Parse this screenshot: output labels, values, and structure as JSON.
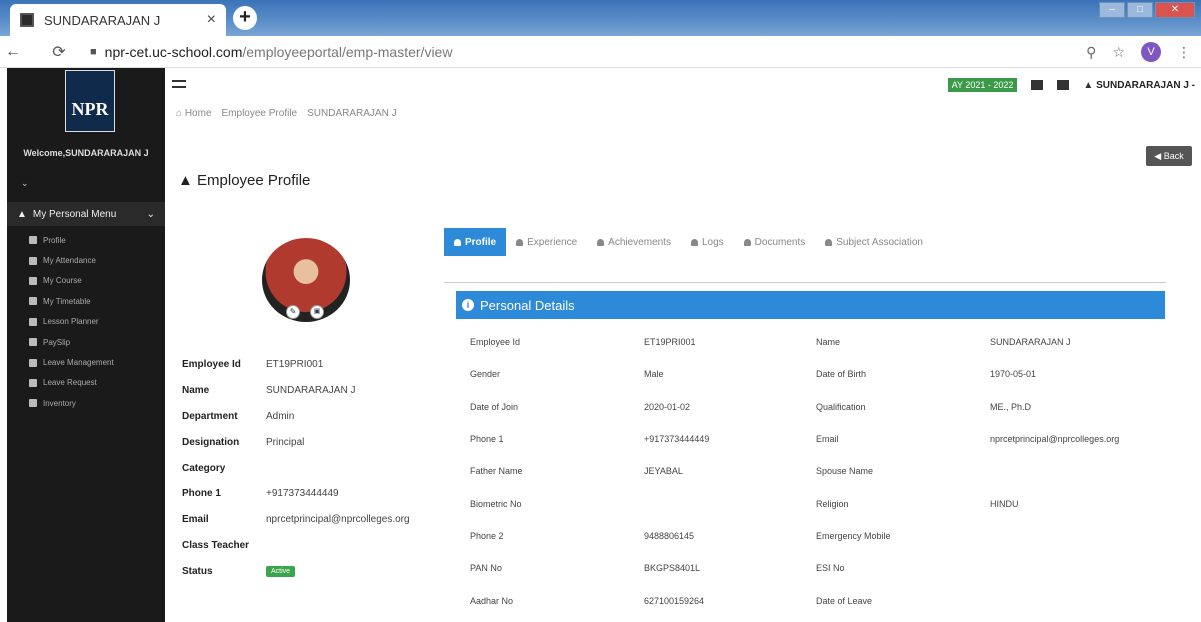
{
  "browser": {
    "tab_title": "SUNDARARAJAN J",
    "tab_close": "×",
    "new_tab": "+",
    "url_host": "npr-cet.uc-school.com",
    "url_path": "/employeeportal/emp-master/view",
    "profile_initial": "V"
  },
  "sidebar": {
    "logo_text": "NPR",
    "welcome": "Welcome,SUNDARARAJAN J",
    "section_label": "My Personal Menu",
    "items": [
      {
        "label": "Profile"
      },
      {
        "label": "My Attendance"
      },
      {
        "label": "My Course"
      },
      {
        "label": "My Timetable"
      },
      {
        "label": "Lesson Planner"
      },
      {
        "label": "PaySlip"
      },
      {
        "label": "Leave Management"
      },
      {
        "label": "Leave Request"
      },
      {
        "label": "Inventory"
      }
    ]
  },
  "header": {
    "academic_year": "AY 2021 - 2022",
    "user_name": "SUNDARARAJAN J -"
  },
  "breadcrumb": [
    "Home",
    "Employee Profile",
    "SUNDARARAJAN J"
  ],
  "page_title": "Employee Profile",
  "back_label": "Back",
  "summary": [
    {
      "label": "Employee Id",
      "value": "ET19PRI001"
    },
    {
      "label": "Name",
      "value": "SUNDARARAJAN J"
    },
    {
      "label": "Department",
      "value": "Admin"
    },
    {
      "label": "Designation",
      "value": "Principal"
    },
    {
      "label": "Category",
      "value": ""
    },
    {
      "label": "Phone 1",
      "value": "+917373444449"
    },
    {
      "label": "Email",
      "value": "nprcetprincipal@nprcolleges.org"
    },
    {
      "label": "Class Teacher",
      "value": ""
    },
    {
      "label": "Status",
      "value": "Active"
    }
  ],
  "tabs": [
    "Profile",
    "Experience",
    "Achievements",
    "Logs",
    "Documents",
    "Subject Association"
  ],
  "panel_title": "Personal Details",
  "details": [
    [
      "Employee Id",
      "ET19PRI001",
      "Name",
      "SUNDARARAJAN J"
    ],
    [
      "Gender",
      "Male",
      "Date of Birth",
      "1970-05-01"
    ],
    [
      "Date of Join",
      "2020-01-02",
      "Qualification",
      "ME., Ph.D"
    ],
    [
      "Phone 1",
      "+917373444449",
      "Email",
      "nprcetprincipal@nprcolleges.org"
    ],
    [
      "Father Name",
      "JEYABAL",
      "Spouse Name",
      ""
    ],
    [
      "Biometric No",
      "",
      "Religion",
      "HINDU"
    ],
    [
      "Phone 2",
      "9488806145",
      "Emergency Mobile",
      ""
    ],
    [
      "PAN No",
      "BKGPS8401L",
      "ESI No",
      ""
    ],
    [
      "Aadhar No",
      "627100159264",
      "Date of Leave",
      ""
    ]
  ]
}
